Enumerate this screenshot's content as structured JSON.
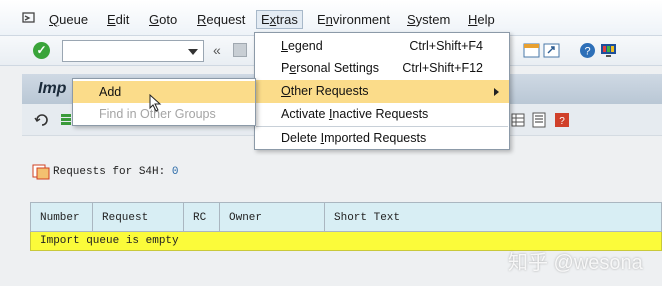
{
  "menubar": {
    "icon": "sap-menu-icon",
    "items": [
      {
        "label": "Queue",
        "ul": "Q"
      },
      {
        "label": "Edit",
        "ul": "E"
      },
      {
        "label": "Goto",
        "ul": "G"
      },
      {
        "label": "Request",
        "ul": "R"
      },
      {
        "label": "Extras",
        "ul": "x"
      },
      {
        "label": "Environment",
        "ul": "n"
      },
      {
        "label": "System",
        "ul": "S"
      },
      {
        "label": "Help",
        "ul": "H"
      }
    ]
  },
  "toolbar": {
    "ok_icon": "check-icon",
    "command_value": "",
    "chevron": "«"
  },
  "title": "Imp",
  "extras_menu": {
    "items": [
      {
        "label": "Legend",
        "shortcut": "Ctrl+Shift+F4"
      },
      {
        "label": "Personal Settings",
        "shortcut": "Ctrl+Shift+F12"
      },
      {
        "label": "Other Requests",
        "shortcut": ""
      },
      {
        "label": "Activate Inactive Requests",
        "shortcut": ""
      },
      {
        "label": "Delete Imported Requests",
        "shortcut": ""
      }
    ]
  },
  "sub_menu": {
    "items": [
      {
        "label": "Add",
        "enabled": true
      },
      {
        "label": "Find in Other Groups",
        "enabled": false
      }
    ]
  },
  "requests": {
    "label": "Requests for S4H:",
    "count": "0"
  },
  "grid": {
    "columns": [
      "Number",
      "Request",
      "RC",
      "Owner",
      "Short Text"
    ],
    "empty_message": "Import queue is empty"
  },
  "watermark": "知乎 @wesona",
  "colors": {
    "highlight": "#fbdc8a",
    "empty_row": "#fbfb3a",
    "grid_header": "#d8eef4",
    "title_bar": "#c5d2de"
  }
}
